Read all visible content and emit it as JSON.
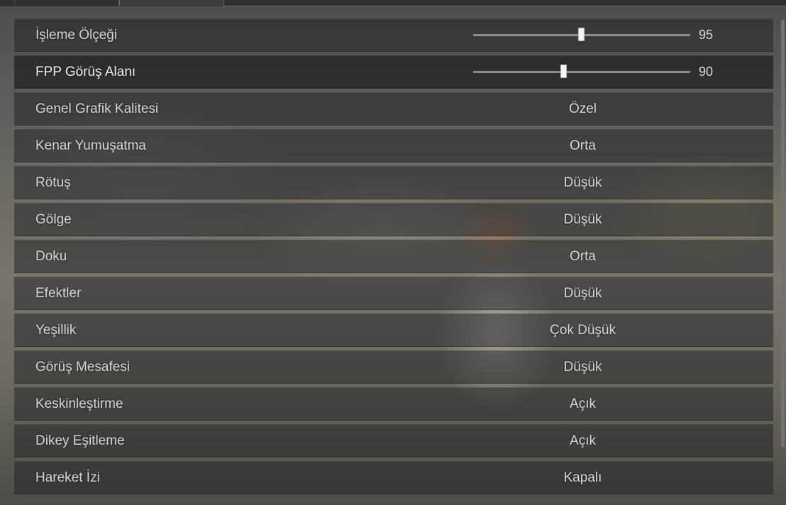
{
  "sliders": [
    {
      "label": "İşleme Ölçeği",
      "value": "95",
      "fill": 0.5
    },
    {
      "label": "FPP Görüş Alanı",
      "value": "90",
      "fill": 0.417
    }
  ],
  "settings": [
    {
      "label": "Genel Grafik Kalitesi",
      "value": "Özel"
    },
    {
      "label": "Kenar Yumuşatma",
      "value": "Orta"
    },
    {
      "label": "Rötuş",
      "value": "Düşük"
    },
    {
      "label": "Gölge",
      "value": "Düşük"
    },
    {
      "label": "Doku",
      "value": "Orta"
    },
    {
      "label": "Efektler",
      "value": "Düşük"
    },
    {
      "label": "Yeşillik",
      "value": "Çok Düşük"
    },
    {
      "label": "Görüş Mesafesi",
      "value": "Düşük"
    },
    {
      "label": "Keskinleştirme",
      "value": "Açık"
    },
    {
      "label": "Dikey Eşitleme",
      "value": "Açık"
    },
    {
      "label": "Hareket İzi",
      "value": "Kapalı"
    }
  ]
}
